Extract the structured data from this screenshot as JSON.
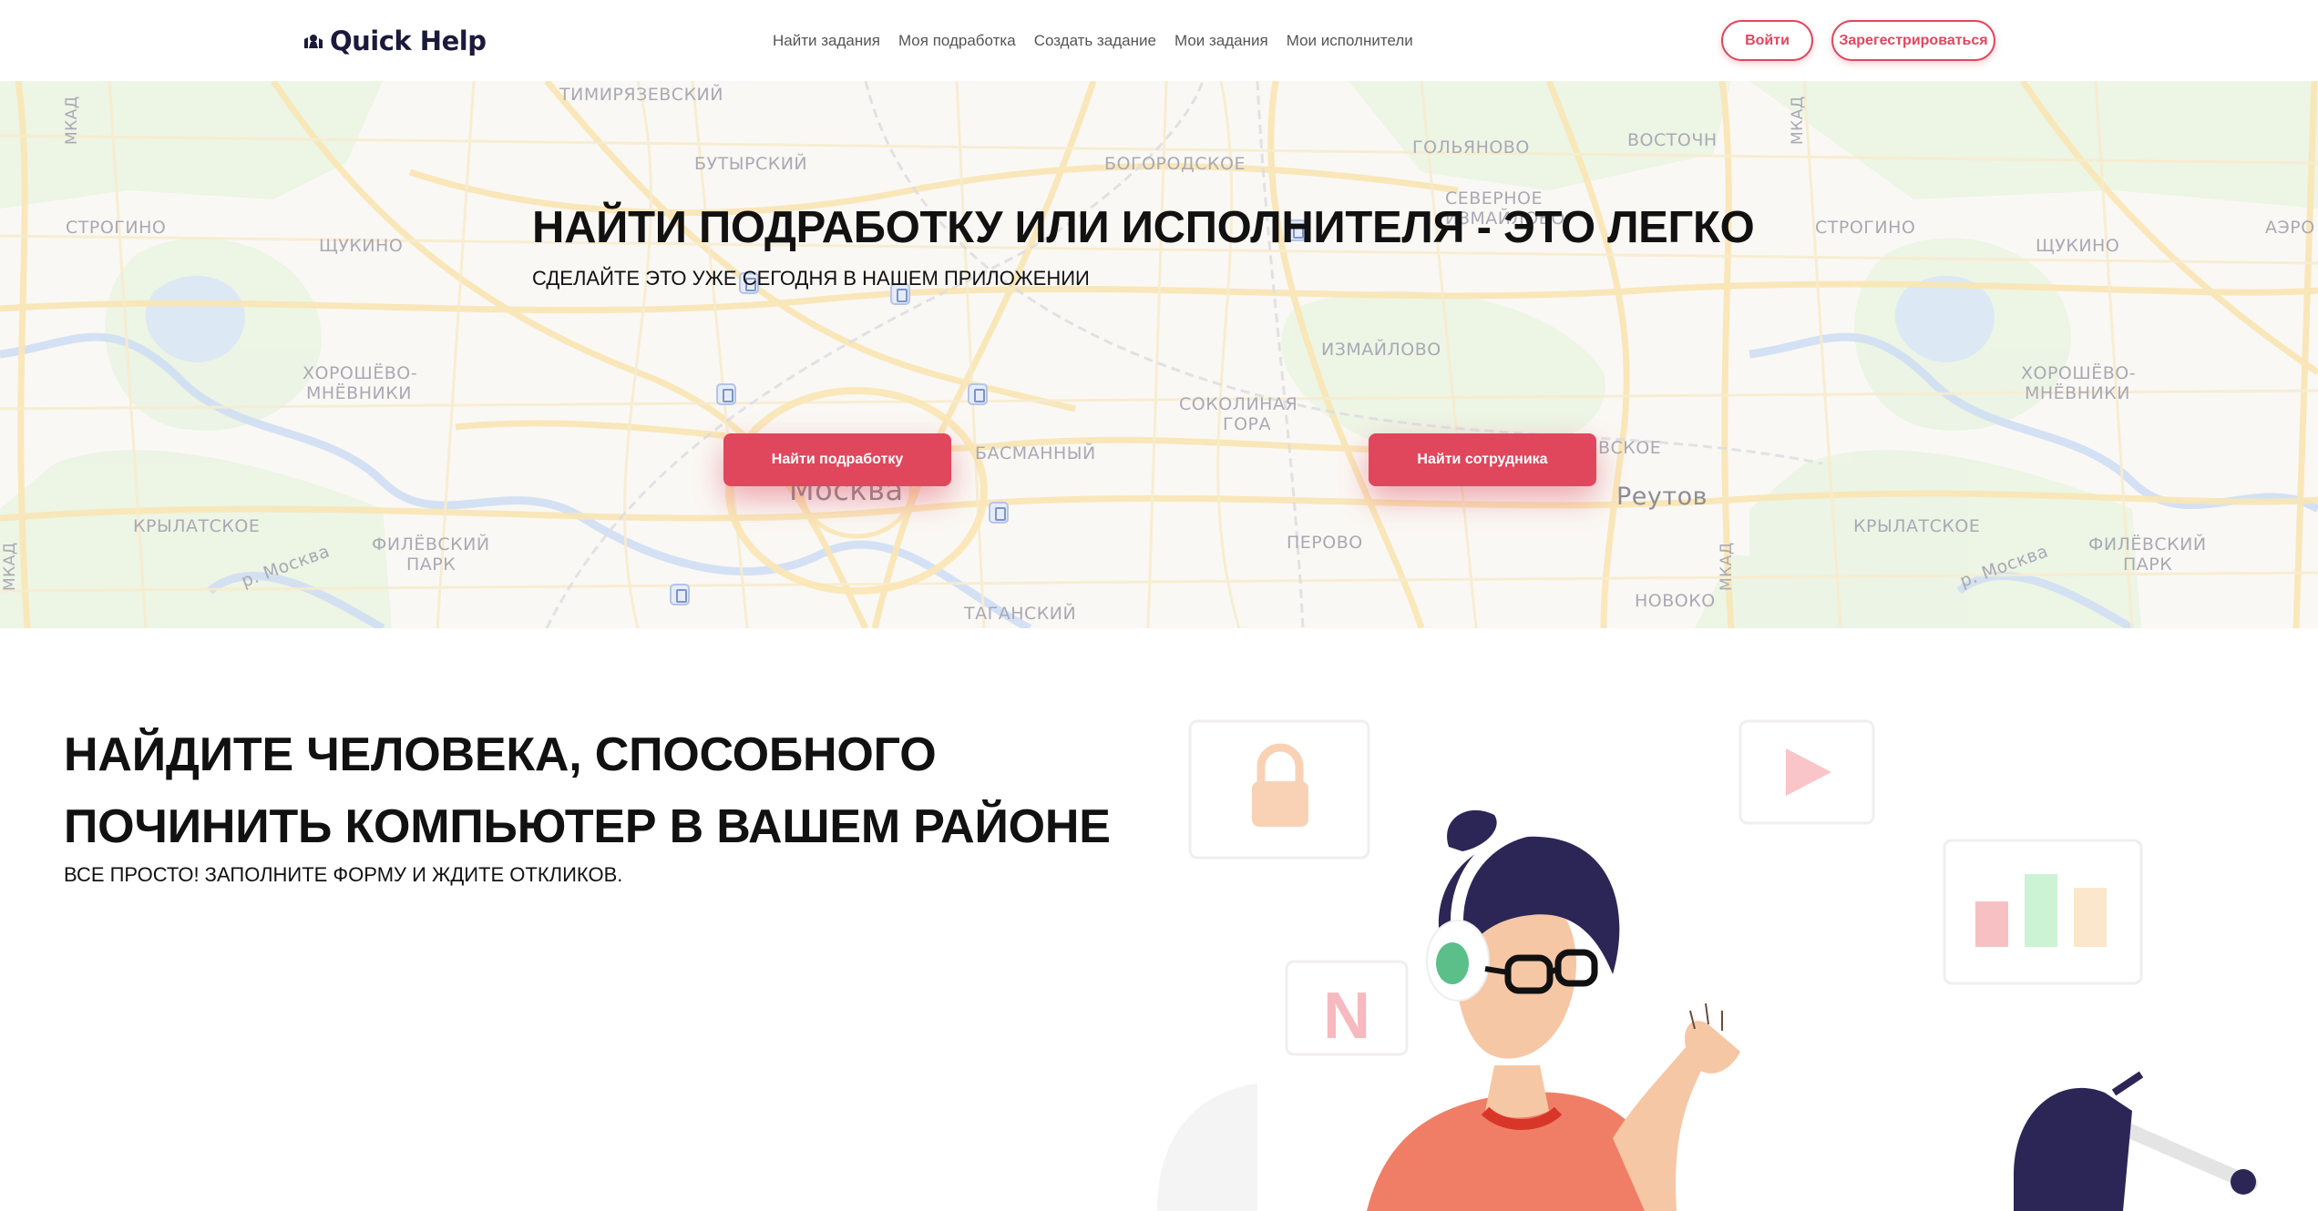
{
  "header": {
    "logo_text": "Quick Help",
    "nav": [
      {
        "label": "Найти задания"
      },
      {
        "label": "Моя подработка"
      },
      {
        "label": "Создать задание"
      },
      {
        "label": "Мои задания"
      },
      {
        "label": "Мои исполнители"
      }
    ],
    "login_label": "Войти",
    "register_label": "Зарегестрироваться"
  },
  "hero": {
    "title_main": "НАЙТИ ПОДРАБОТКУ ИЛИ ИСПОЛНИТЕЛЯ - ",
    "title_strong": "ЭТО ЛЕГКО",
    "subtitle": "СДЕЛАЙТЕ ЭТО УЖЕ СЕГОДНЯ В НАШЕМ ПРИЛОЖЕНИИ",
    "find_job_label": "Найти подработку",
    "find_worker_label": "Найти сотрудника",
    "map_labels": {
      "timiryazevsky": "ТИМИРЯЗЕВСКИЙ",
      "butyrsky": "БУТЫРСКИЙ",
      "bogorodskoe": "БОГОРОДСКОЕ",
      "golyanovo": "ГОЛЬЯНОВО",
      "vostochny": "ВОСТОЧН",
      "severnoe_izmaylovo_1": "СЕВЕРНОЕ",
      "severnoe_izmaylovo_2": "ИЗМАЙЛОВО",
      "strogino": "СТРОГИНО",
      "shchukino": "ЩУКИНО",
      "izmaylovo": "ИЗМАЙЛОВО",
      "khoroshevo_1": "ХОРОШЁВО-",
      "khoroshevo_2": "МНЁВНИКИ",
      "sokolinaya_1": "СОКОЛИНАЯ",
      "sokolinaya_2": "ГОРА",
      "basmanny": "БАСМАННЫЙ",
      "moskva": "Москва",
      "reutov": "Реутов",
      "krylatskoe": "КРЫЛАТСКОЕ",
      "filevsky_1": "ФИЛЁВСКИЙ",
      "filevsky_2": "ПАРК",
      "perovo": "ПЕРОВО",
      "tagansky": "ТАГАНСКИЙ",
      "novokosino": "НОВОКО",
      "r_moskva": "р. Москва",
      "mkad": "МКАД",
      "aero": "АЭРО",
      "vyhino": "ВСКОЕ"
    }
  },
  "section": {
    "title": "НАЙДИТЕ ЧЕЛОВЕКА, СПОСОБНОГО ПОЧИНИТЬ КОМПЬЮТЕР В ВАШЕМ РАЙОНЕ",
    "subtitle": "ВСЕ ПРОСТО! ЗАПОЛНИТЕ ФОРМУ И ЖДИТЕ ОТКЛИКОВ.",
    "illustration_letter": "N"
  },
  "colors": {
    "accent": "#e0475d",
    "navy": "#1c1a3b",
    "text": "#111111",
    "nav_text": "#555555"
  }
}
